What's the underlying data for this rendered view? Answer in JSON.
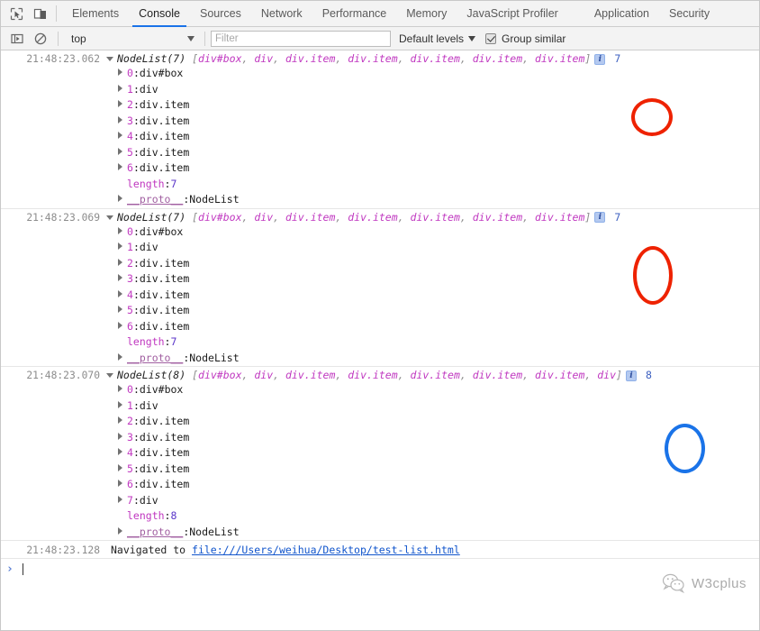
{
  "window": {
    "title": "Chrome DevTools Console"
  },
  "toolbar": {
    "inspect_icon": "inspect-cursor-icon",
    "device_icon": "device-toolbar-icon"
  },
  "tabs": [
    {
      "label": "Elements",
      "active": false
    },
    {
      "label": "Console",
      "active": true
    },
    {
      "label": "Sources",
      "active": false
    },
    {
      "label": "Network",
      "active": false
    },
    {
      "label": "Performance",
      "active": false
    },
    {
      "label": "Memory",
      "active": false
    },
    {
      "label": "JavaScript Profiler",
      "active": false
    },
    {
      "label": "Application",
      "active": false
    },
    {
      "label": "Security",
      "active": false
    }
  ],
  "filterbar": {
    "sidebar_icon": "console-sidebar-icon",
    "clear_icon": "clear-console-icon",
    "context": "top",
    "filter_placeholder": "Filter",
    "filter_value": "",
    "levels_label": "Default levels",
    "group_similar_label": "Group similar",
    "group_similar_checked": true
  },
  "colors": {
    "accent": "#1a73e8",
    "node_token": "#c038c0",
    "annotation_red": "#ee2200",
    "annotation_blue": "#1a73e8",
    "link": "#1155cc",
    "timestamp": "#8c8c8c"
  },
  "entries": [
    {
      "timestamp": "21:48:23.062",
      "class_name": "NodeList(7)",
      "preview_nodes": [
        "div#box",
        "div",
        "div.item",
        "div.item",
        "div.item",
        "div.item",
        "div.item"
      ],
      "info_icon": "i",
      "count": "7",
      "annotation": {
        "shape": "circle",
        "color": "#ee2200"
      },
      "props": [
        {
          "expandable": true,
          "key": "0",
          "value": "div#box"
        },
        {
          "expandable": true,
          "key": "1",
          "value": "div"
        },
        {
          "expandable": true,
          "key": "2",
          "value": "div.item"
        },
        {
          "expandable": true,
          "key": "3",
          "value": "div.item"
        },
        {
          "expandable": true,
          "key": "4",
          "value": "div.item"
        },
        {
          "expandable": true,
          "key": "5",
          "value": "div.item"
        },
        {
          "expandable": true,
          "key": "6",
          "value": "div.item"
        },
        {
          "expandable": false,
          "key": "length",
          "value": "7",
          "kind": "number"
        },
        {
          "expandable": true,
          "key": "__proto__",
          "value": "NodeList",
          "kind": "proto"
        }
      ]
    },
    {
      "timestamp": "21:48:23.069",
      "class_name": "NodeList(7)",
      "preview_nodes": [
        "div#box",
        "div",
        "div.item",
        "div.item",
        "div.item",
        "div.item",
        "div.item"
      ],
      "info_icon": "i",
      "count": "7",
      "annotation": {
        "shape": "ellipse",
        "color": "#ee2200"
      },
      "props": [
        {
          "expandable": true,
          "key": "0",
          "value": "div#box"
        },
        {
          "expandable": true,
          "key": "1",
          "value": "div"
        },
        {
          "expandable": true,
          "key": "2",
          "value": "div.item"
        },
        {
          "expandable": true,
          "key": "3",
          "value": "div.item"
        },
        {
          "expandable": true,
          "key": "4",
          "value": "div.item"
        },
        {
          "expandable": true,
          "key": "5",
          "value": "div.item"
        },
        {
          "expandable": true,
          "key": "6",
          "value": "div.item"
        },
        {
          "expandable": false,
          "key": "length",
          "value": "7",
          "kind": "number"
        },
        {
          "expandable": true,
          "key": "__proto__",
          "value": "NodeList",
          "kind": "proto"
        }
      ]
    },
    {
      "timestamp": "21:48:23.070",
      "class_name": "NodeList(8)",
      "preview_nodes": [
        "div#box",
        "div",
        "div.item",
        "div.item",
        "div.item",
        "div.item",
        "div.item",
        "div"
      ],
      "info_icon": "i",
      "count": "8",
      "annotation": {
        "shape": "ellipse",
        "color": "#1a73e8"
      },
      "props": [
        {
          "expandable": true,
          "key": "0",
          "value": "div#box"
        },
        {
          "expandable": true,
          "key": "1",
          "value": "div"
        },
        {
          "expandable": true,
          "key": "2",
          "value": "div.item"
        },
        {
          "expandable": true,
          "key": "3",
          "value": "div.item"
        },
        {
          "expandable": true,
          "key": "4",
          "value": "div.item"
        },
        {
          "expandable": true,
          "key": "5",
          "value": "div.item"
        },
        {
          "expandable": true,
          "key": "6",
          "value": "div.item"
        },
        {
          "expandable": true,
          "key": "7",
          "value": "div"
        },
        {
          "expandable": false,
          "key": "length",
          "value": "8",
          "kind": "number"
        },
        {
          "expandable": true,
          "key": "__proto__",
          "value": "NodeList",
          "kind": "proto"
        }
      ]
    }
  ],
  "navigated": {
    "timestamp": "21:48:23.128",
    "text": "Navigated to",
    "url": "file:///Users/weihua/Desktop/test-list.html"
  },
  "prompt": {
    "arrow": "›",
    "value": ""
  },
  "watermark": {
    "icon": "wechat-icon",
    "text": "W3cplus"
  }
}
